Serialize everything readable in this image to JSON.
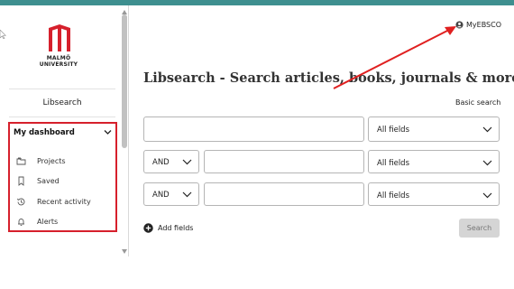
{
  "colors": {
    "top_bar": "#3e8f8f",
    "brand_red": "#d6202c",
    "annotation_red": "#e02020",
    "disabled_button": "#d5d5d5"
  },
  "sidebar": {
    "logo": {
      "line1": "MALMÖ",
      "line2": "UNIVERSITY",
      "icon": "malmo-university-logo-icon"
    },
    "libsearch_label": "Libsearch",
    "dashboard": {
      "title": "My dashboard",
      "items": [
        {
          "label": "Projects",
          "icon": "folders-icon"
        },
        {
          "label": "Saved",
          "icon": "bookmark-icon"
        },
        {
          "label": "Recent activity",
          "icon": "history-icon"
        },
        {
          "label": "Alerts",
          "icon": "bell-icon"
        }
      ]
    }
  },
  "header": {
    "account_label": "MyEBSCO",
    "account_icon": "user-circle-icon"
  },
  "main": {
    "title": "Libsearch - Search articles, books, journals & more",
    "basic_search_link": "Basic search",
    "rows": [
      {
        "operator": null,
        "term": "",
        "field": "All fields"
      },
      {
        "operator": "AND",
        "term": "",
        "field": "All fields"
      },
      {
        "operator": "AND",
        "term": "",
        "field": "All fields"
      }
    ],
    "add_fields_label": "Add fields",
    "search_button": "Search"
  }
}
